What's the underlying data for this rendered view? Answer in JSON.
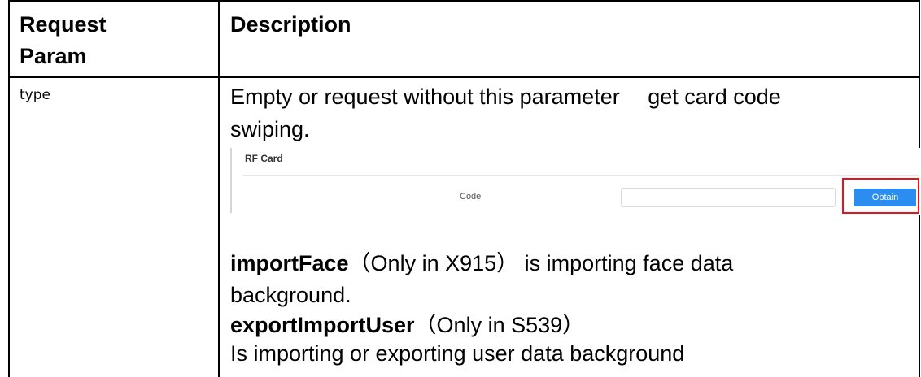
{
  "table": {
    "header": {
      "param_line1": "Request",
      "param_line2": "Param",
      "description": "Description"
    },
    "rows": [
      {
        "param": "type",
        "description_lines": {
          "line1": "Empty or request without this parameter　 get card code",
          "line2": "swiping.",
          "import_face_key": "importFace",
          "import_face_note": "（Only in X915） is importing face data",
          "import_face_cont": "background.",
          "export_key": "exportImportUser",
          "export_note": "（Only in S539）",
          "export_cont": "Is importing or exporting user data background"
        }
      }
    ]
  },
  "rf_card": {
    "title": "RF Card",
    "code_label": "Code",
    "code_value": "",
    "obtain_label": "Obtain",
    "button_color": "#2b8df0",
    "highlight_color": "#e2161e"
  }
}
